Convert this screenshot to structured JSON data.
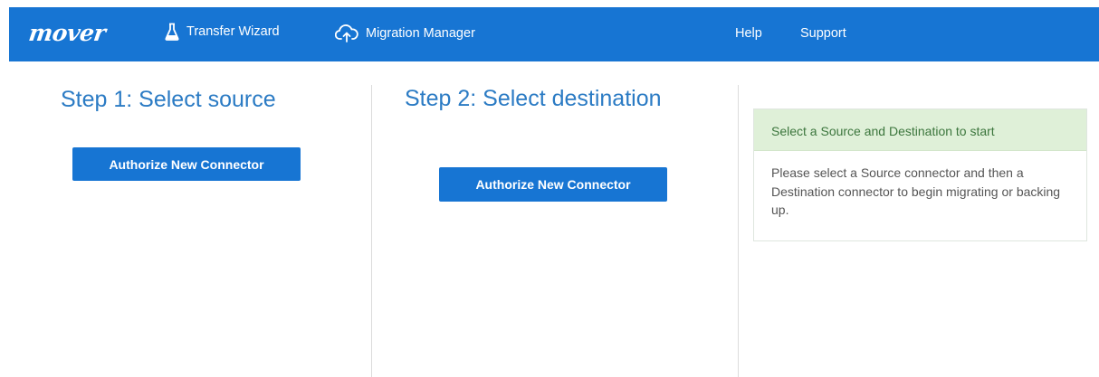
{
  "nav": {
    "logo": "mover",
    "items": [
      {
        "label": "Transfer Wizard",
        "icon": "flask-icon"
      },
      {
        "label": "Migration Manager",
        "icon": "cloud-upload-icon"
      }
    ],
    "help": "Help",
    "support": "Support"
  },
  "steps": [
    {
      "title": "Step 1: Select source",
      "button": "Authorize New Connector"
    },
    {
      "title": "Step 2: Select destination",
      "button": "Authorize New Connector"
    }
  ],
  "panel": {
    "heading": "Select a Source and Destination to start",
    "body": "Please select a Source connector and then a Destination connector to begin migrating or backing up."
  },
  "colors": {
    "brand": "#1775d3",
    "title": "#2b7bc4",
    "panel_heading_bg": "#dff0d8",
    "panel_heading_text": "#3c763d"
  }
}
